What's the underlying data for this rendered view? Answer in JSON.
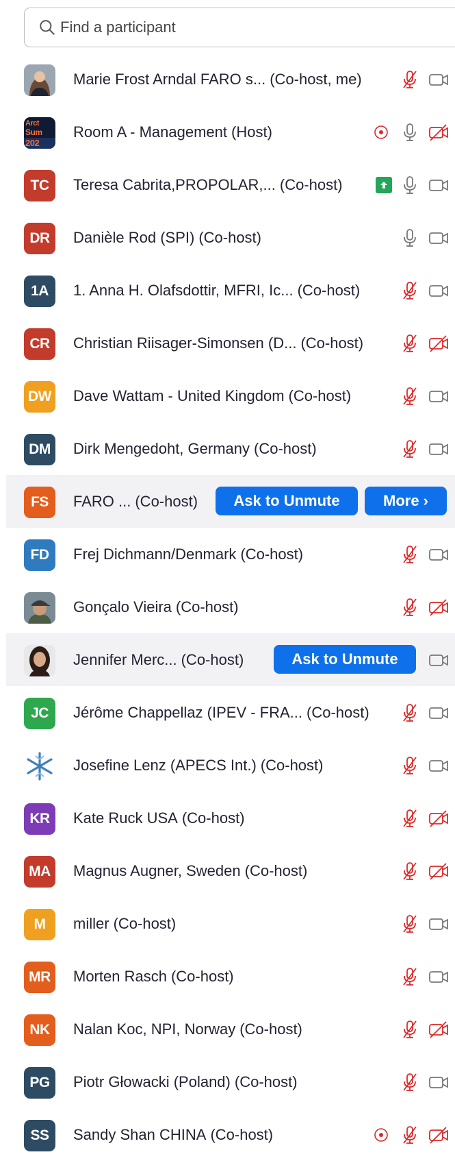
{
  "search": {
    "placeholder": "Find a participant"
  },
  "labels": {
    "ask_to_unmute": "Ask to Unmute",
    "more": "More ›"
  },
  "colors": {
    "accent": "#0e71eb",
    "muted_red": "#e02828",
    "share_green": "#23a65a"
  },
  "participants": [
    {
      "initials": "",
      "avatar": "photo-woman-blonde",
      "name": "Marie Frost Arndal FARO s...",
      "role": "(Co-host, me)",
      "audio": "muted",
      "video": "on"
    },
    {
      "initials": "",
      "avatar": "arctic-summit-logo",
      "avatar_text": "Arct Sum 202",
      "name": "Room A - Management",
      "role": "(Host)",
      "recording": true,
      "audio": "unmuted",
      "video": "off"
    },
    {
      "initials": "TC",
      "color": "#c23b2b",
      "name": "Teresa Cabrita,PROPOLAR,...",
      "role": "(Co-host)",
      "sharing": true,
      "audio": "unmuted",
      "video": "on"
    },
    {
      "initials": "DR",
      "color": "#c23b2b",
      "name": "Danièle Rod (SPI)",
      "role": "(Co-host)",
      "audio": "unmuted",
      "video": "on"
    },
    {
      "initials": "1A",
      "color": "#2d4b63",
      "name": "1. Anna H. Olafsdottir, MFRI, Ic...",
      "role": "(Co-host)",
      "audio": "muted",
      "video": "on"
    },
    {
      "initials": "CR",
      "color": "#c23b2b",
      "name": "Christian Riisager-Simonsen (D...",
      "role": "(Co-host)",
      "audio": "muted",
      "video": "off"
    },
    {
      "initials": "DW",
      "color": "#f0a020",
      "name": "Dave Wattam - United Kingdom",
      "role": "(Co-host)",
      "audio": "muted",
      "video": "on"
    },
    {
      "initials": "DM",
      "color": "#2d4b63",
      "name": "Dirk Mengedoht, Germany",
      "role": "(Co-host)",
      "audio": "muted",
      "video": "on"
    },
    {
      "initials": "FS",
      "color": "#e35d1c",
      "name": "FARO ...",
      "role": "(Co-host)",
      "hover": "more"
    },
    {
      "initials": "FD",
      "color": "#2f7bbf",
      "name": "Frej Dichmann/Denmark",
      "role": "(Co-host)",
      "audio": "muted",
      "video": "on"
    },
    {
      "initials": "",
      "avatar": "photo-man-cap",
      "name": "Gonçalo Vieira",
      "role": "(Co-host)",
      "audio": "muted",
      "video": "off"
    },
    {
      "initials": "",
      "avatar": "photo-woman-darkhair",
      "name": "Jennifer Merc...",
      "role": "(Co-host)",
      "hover": "ask",
      "video": "on"
    },
    {
      "initials": "JC",
      "color": "#2ea84f",
      "name": "Jérôme Chappellaz (IPEV - FRA...",
      "role": "(Co-host)",
      "audio": "muted",
      "video": "on"
    },
    {
      "initials": "",
      "avatar": "snowflake-logo",
      "name": "Josefine Lenz (APECS Int.)",
      "role": "(Co-host)",
      "audio": "muted",
      "video": "on"
    },
    {
      "initials": "KR",
      "color": "#7d3cb5",
      "name": "Kate Ruck USA",
      "role": "(Co-host)",
      "audio": "muted",
      "video": "off"
    },
    {
      "initials": "MA",
      "color": "#c23b2b",
      "name": "Magnus Augner, Sweden",
      "role": "(Co-host)",
      "audio": "muted",
      "video": "off"
    },
    {
      "initials": "M",
      "color": "#f0a020",
      "name": "miller",
      "role": "(Co-host)",
      "audio": "muted",
      "video": "on"
    },
    {
      "initials": "MR",
      "color": "#e35d1c",
      "name": "Morten Rasch",
      "role": "(Co-host)",
      "audio": "muted",
      "video": "on"
    },
    {
      "initials": "NK",
      "color": "#e35d1c",
      "name": "Nalan Koc, NPI, Norway",
      "role": "(Co-host)",
      "audio": "muted",
      "video": "off"
    },
    {
      "initials": "PG",
      "color": "#2d4b63",
      "name": "Piotr Głowacki (Poland)",
      "role": "(Co-host)",
      "audio": "muted",
      "video": "on"
    },
    {
      "initials": "SS",
      "color": "#2d4b63",
      "name": "Sandy Shan CHINA",
      "role": "(Co-host)",
      "recording": true,
      "audio": "muted",
      "video": "off"
    }
  ]
}
